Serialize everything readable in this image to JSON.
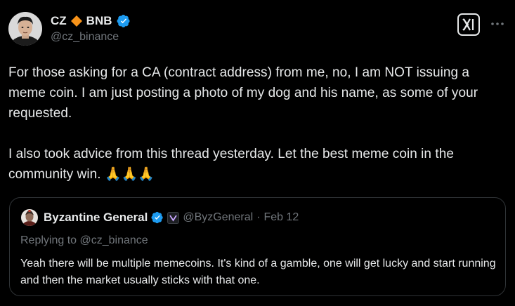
{
  "author": {
    "name": "CZ",
    "suffix": "BNB",
    "handle": "@cz_binance",
    "diamond_color": "#f7931a",
    "verified_color": "#1d9bf0"
  },
  "tweet": {
    "text": "For those asking for a CA (contract address) from me, no, I am NOT issuing a meme coin. I am just posting a photo of my dog and his name, as some of your requested.\n\nI also took advice from this thread yesterday. Let the best meme coin in the community win. 🙏🙏🙏"
  },
  "icons": {
    "x_logo": "x-logo-icon",
    "more": "more-icon"
  },
  "quoted": {
    "name": "Byzantine General",
    "handle": "@ByzGeneral",
    "separator": "·",
    "date": "Feb 12",
    "reply_prefix": "Replying to ",
    "reply_to": "@cz_binance",
    "text": "Yeah there will be multiple memecoins. It's kind of a gamble, one will get lucky and start running and then the market usually sticks with that one."
  }
}
